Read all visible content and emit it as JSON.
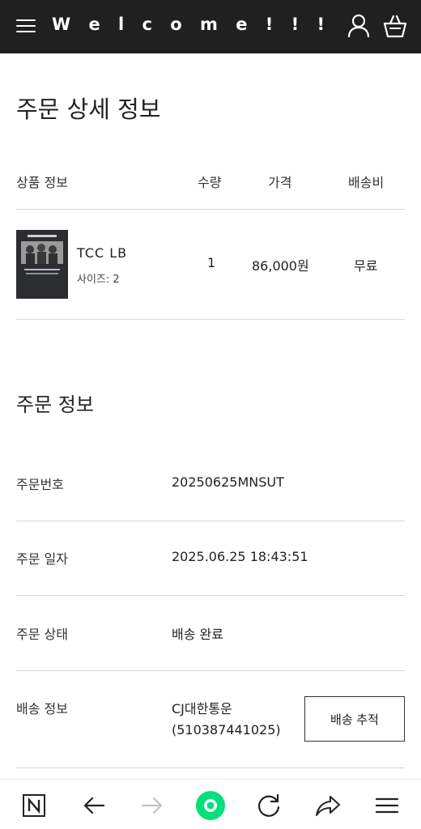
{
  "header": {
    "brand": "W e l c o m e ! ! !",
    "menu_icon": "hamburger-menu-icon",
    "user_icon": "user-icon",
    "cart_icon": "shopping-basket-icon",
    "background": "#202020"
  },
  "page": {
    "title": "주문 상세 정보"
  },
  "product_table": {
    "headers": {
      "product": "상품 정보",
      "quantity": "수량",
      "price": "가격",
      "shipping": "배송비"
    },
    "rows": [
      {
        "name": "TCC LB",
        "option": "사이즈: 2",
        "quantity": "1",
        "price": "86,000원",
        "shipping": "무료"
      }
    ]
  },
  "order_info": {
    "title": "주문 정보",
    "rows": [
      {
        "label": "주문번호",
        "value": "20250625MNSUT"
      },
      {
        "label": "주문 일자",
        "value": "2025.06.25 18:43:51"
      },
      {
        "label": "주문 상태",
        "value": "배송 완료"
      },
      {
        "label": "배송 정보",
        "value": "CJ대한통운",
        "value2": "(510387441025)"
      }
    ],
    "track_button": "배송 추적"
  },
  "browser_nav": {
    "icons": [
      "naver-n-icon",
      "back-arrow-icon",
      "forward-arrow-icon",
      "home-dot-icon",
      "refresh-icon",
      "share-icon",
      "menu-icon"
    ],
    "accent": "#03e07a"
  }
}
